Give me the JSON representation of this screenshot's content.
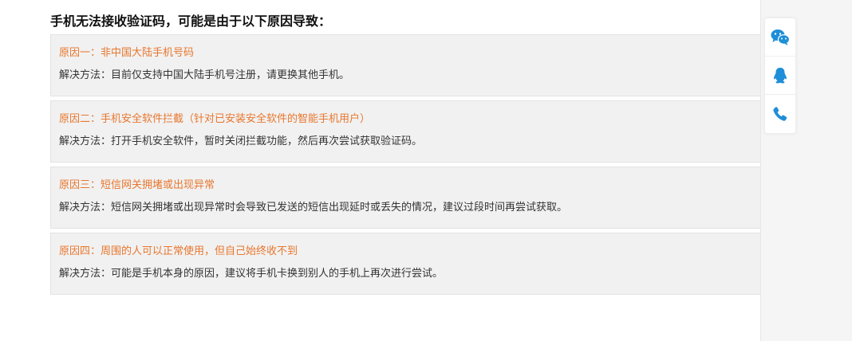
{
  "heading": "手机无法接收验证码，可能是由于以下原因导致：",
  "reasons": [
    {
      "title": "原因一：非中国大陆手机号码",
      "solution": "解决方法：目前仅支持中国大陆手机号注册，请更换其他手机。"
    },
    {
      "title": "原因二：手机安全软件拦截（针对已安装安全软件的智能手机用户）",
      "solution": "解决方法：打开手机安全软件，暂时关闭拦截功能，然后再次尝试获取验证码。"
    },
    {
      "title": "原因三：短信网关拥堵或出现异常",
      "solution": "解决方法：短信网关拥堵或出现异常时会导致已发送的短信出现延时或丢失的情况，建议过段时间再尝试获取。"
    },
    {
      "title": "原因四：周围的人可以正常使用，但自己始终收不到",
      "solution": "解决方法：可能是手机本身的原因，建议将手机卡换到别人的手机上再次进行尝试。"
    }
  ],
  "side_toolbar": {
    "buttons": [
      {
        "icon": "wechat-icon"
      },
      {
        "icon": "qq-icon"
      },
      {
        "icon": "phone-icon"
      }
    ],
    "icon_color": "#1e8ed8"
  },
  "colors": {
    "reason_title": "#e8772e",
    "solution_text": "#333333",
    "box_background": "#f1f1f1"
  }
}
